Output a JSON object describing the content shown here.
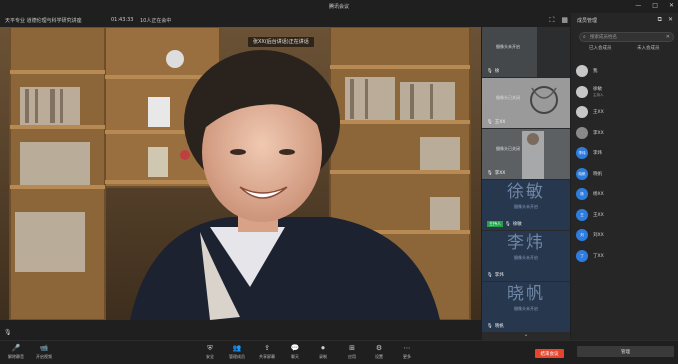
{
  "window": {
    "title": "腾讯会议",
    "controls": [
      "minimize-icon",
      "maximize-icon",
      "close-icon"
    ]
  },
  "info_bar": {
    "meeting_name": "天平专业 道德伦理与科学研究讲座",
    "elapsed": "01:43:33",
    "status": "10人正在会中"
  },
  "main_video": {
    "speaker_banner": "张XX(后台讲话)正在讲话"
  },
  "video_strip": {
    "tiles": [
      {
        "name": "徐",
        "caption": "摄像头未开启"
      },
      {
        "name": "王XX",
        "caption": "摄像头已关闭"
      },
      {
        "name": "李XX",
        "caption": "摄像头已关闭"
      },
      {
        "name": "徐敏",
        "badge": "主持人",
        "sub": "摄像头未开启"
      },
      {
        "name": "李炜",
        "sub": "摄像头未开启"
      },
      {
        "name": "晓帆",
        "sub": "摄像头未开启"
      }
    ]
  },
  "participants": {
    "title": "成员管理",
    "search_placeholder": "搜索成员姓名",
    "tabs": [
      "已入会成员",
      "未入会成员"
    ],
    "list": [
      {
        "initial": "",
        "name": "我",
        "sub": ""
      },
      {
        "initial": "",
        "name": "徐敏",
        "sub": "主持人"
      },
      {
        "initial": "",
        "name": "王XX",
        "sub": ""
      },
      {
        "initial": "",
        "name": "李XX",
        "sub": ""
      },
      {
        "initial": "李炜",
        "name": "李炜",
        "sub": ""
      },
      {
        "initial": "晓帆",
        "name": "晓帆",
        "sub": ""
      },
      {
        "initial": "杨",
        "name": "杨XX",
        "sub": ""
      },
      {
        "initial": "王",
        "name": "王XX",
        "sub": ""
      },
      {
        "initial": "刘",
        "name": "刘XX",
        "sub": ""
      },
      {
        "initial": "丁",
        "name": "丁XX",
        "sub": ""
      }
    ]
  },
  "toolbar": {
    "items": [
      {
        "icon": "mic-icon",
        "label": "解除静音"
      },
      {
        "icon": "camera-icon",
        "label": "开启视频"
      },
      {
        "icon": "security-icon",
        "label": "安全"
      },
      {
        "icon": "members-icon",
        "label": "管理成员"
      },
      {
        "icon": "share-icon",
        "label": "共享屏幕"
      },
      {
        "icon": "chat-icon",
        "label": "聊天"
      },
      {
        "icon": "record-icon",
        "label": "录制"
      },
      {
        "icon": "apps-icon",
        "label": "应用"
      },
      {
        "icon": "settings-icon",
        "label": "设置"
      },
      {
        "icon": "more-icon",
        "label": "更多"
      }
    ],
    "leave_label": "结束会议",
    "panel_label": "管理"
  },
  "colors": {
    "accent": "#2d7de0",
    "danger": "#e8432b",
    "host_badge": "#24a24a"
  }
}
